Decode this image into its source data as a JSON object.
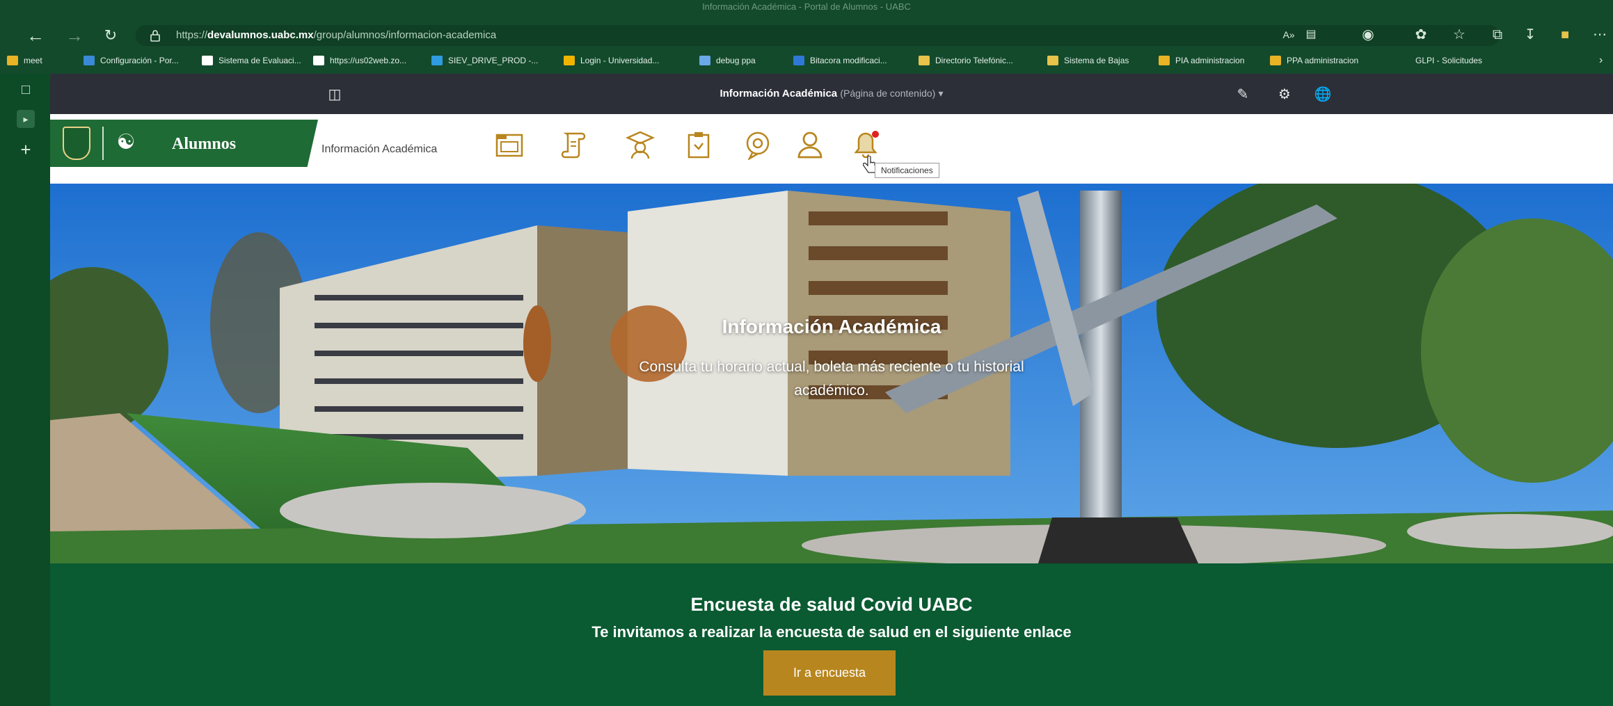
{
  "browser": {
    "window_title": "Información Académica - Portal de Alumnos - UABC",
    "url_prefix": "https://",
    "url_domain": "devalumnos.uabc.mx",
    "url_path": "/group/alumnos/informacion-academica",
    "read_aloud": "A»",
    "bookmarks": [
      {
        "label": "meet",
        "icon_color": "#e8b325"
      },
      {
        "label": "Configuración - Por...",
        "icon_color": "#3a8ad8"
      },
      {
        "label": "Sistema de Evaluaci...",
        "icon_color": "#ffffff"
      },
      {
        "label": "https://us02web.zo...",
        "icon_color": "#ffffff"
      },
      {
        "label": "SIEV_DRIVE_PROD -...",
        "icon_color": "#2f9be0"
      },
      {
        "label": "Login - Universidad...",
        "icon_color": "#f0b400"
      },
      {
        "label": "debug ppa",
        "icon_color": "#6aa8e8"
      },
      {
        "label": "Bitacora modificaci...",
        "icon_color": "#2f78d8"
      },
      {
        "label": "Directorio Telefónic...",
        "icon_color": "#e8c24a"
      },
      {
        "label": "Sistema de Bajas",
        "icon_color": "#e8c24a"
      },
      {
        "label": "PIA administracion",
        "icon_color": "#e8b325"
      },
      {
        "label": "PPA administracion",
        "icon_color": "#e8b325"
      },
      {
        "label": "GLPI - Solicitudes",
        "icon_color": "#134a2c"
      }
    ]
  },
  "command_bar": {
    "title": "Información Académica",
    "subtitle": "(Página de contenido)"
  },
  "site_header": {
    "site_name": "Alumnos",
    "page_name": "Información Académica",
    "tooltip": "Notificaciones",
    "nav_icons": [
      "folder-icon",
      "scroll-icon",
      "graduate-icon",
      "clipboard-icon",
      "chat-icon",
      "user-icon",
      "bell-icon"
    ]
  },
  "hero": {
    "title": "Información Académica",
    "subtitle_line1": "Consulta tu horario actual, boleta más reciente o tu historial",
    "subtitle_line2": "académico."
  },
  "covid_banner": {
    "title": "Encuesta de salud Covid UABC",
    "subtitle": "Te invitamos a realizar la encuesta de salud en el siguiente enlace",
    "button_label": "Ir a encuesta"
  },
  "colors": {
    "browser_green": "#134a2c",
    "brand_green": "#1f6b35",
    "banner_green": "#0a5a32",
    "button_gold": "#b8861e",
    "icon_gold": "#b8861e",
    "notification_dot": "#e02020"
  }
}
